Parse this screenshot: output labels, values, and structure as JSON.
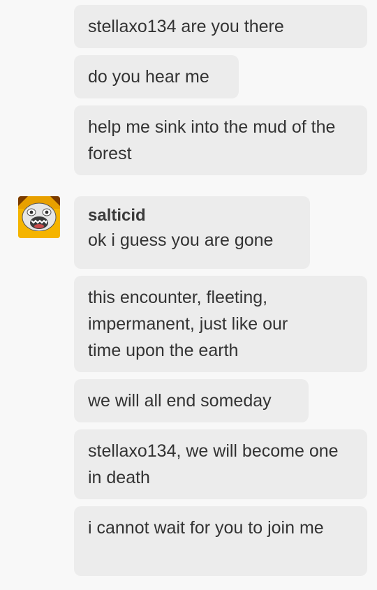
{
  "messages": [
    {
      "text": "stellaxo134 are you there"
    },
    {
      "text": "do you hear me"
    },
    {
      "text": "help me sink into the mud of the forest"
    },
    {
      "sender": "salticid",
      "text": "ok i guess you are gone"
    },
    {
      "text": "this encounter, fleeting, impermanent, just like our time upon the earth"
    },
    {
      "text": "we will all end someday"
    },
    {
      "text": "stellaxo134, we will become one in death"
    },
    {
      "text": "i cannot wait for you to join me"
    }
  ],
  "avatar": {
    "icon": "screaming-face-avatar-icon",
    "colors": {
      "background": "#f5b400",
      "face": "#e6e6e6",
      "mouth": "#3b3b3b"
    }
  },
  "colors": {
    "page_bg": "#f8f8f8",
    "bubble_bg": "#ececec",
    "text": "#333333"
  }
}
